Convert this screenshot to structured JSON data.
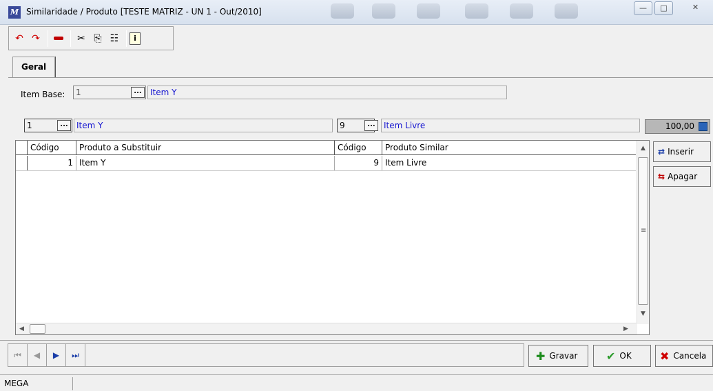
{
  "window": {
    "title": "Similaridade / Produto [TESTE MATRIZ - UN 1 - Out/2010]",
    "minimize": "—",
    "maximize": "□",
    "close": "✕"
  },
  "toolbar": {
    "icons": [
      "undo-icon",
      "redo-icon",
      "delete-icon",
      "cut-icon",
      "copy-icon",
      "paste-icon",
      "info-icon"
    ]
  },
  "tabs": [
    {
      "label": "Geral"
    }
  ],
  "item_base": {
    "label": "Item Base:",
    "code": "1",
    "description": "Item Y"
  },
  "filter": {
    "left_code": "1",
    "left_description": "Item Y",
    "right_code": "9",
    "right_description": "Item Livre",
    "total": "100,00"
  },
  "grid": {
    "columns": [
      "Código",
      "Produto a Substituir",
      "Código",
      "Produto Similar"
    ],
    "rows": [
      {
        "code1": "1",
        "product": "Item Y",
        "code2": "9",
        "similar": "Item Livre"
      }
    ]
  },
  "side_buttons": {
    "insert": "Inserir",
    "delete": "Apagar"
  },
  "actions": {
    "save": "Gravar",
    "ok": "OK",
    "cancel": "Cancela"
  },
  "status": {
    "company": "MEGA"
  }
}
